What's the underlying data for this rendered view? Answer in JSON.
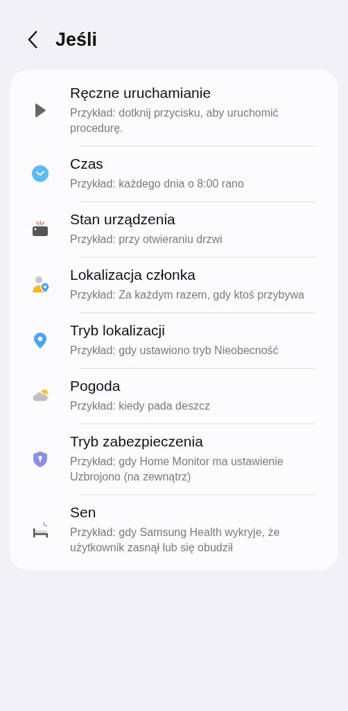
{
  "header": {
    "title": "Jeśli"
  },
  "items": [
    {
      "kind": "manual",
      "title": "Ręczne uruchamianie",
      "subtitle": "Przykład: dotknij przycisku, aby uruchomić procedurę."
    },
    {
      "kind": "time",
      "title": "Czas",
      "subtitle": "Przykład: każdego dnia o 8:00 rano"
    },
    {
      "kind": "device",
      "title": "Stan urządzenia",
      "subtitle": "Przykład: przy otwieraniu drzwi"
    },
    {
      "kind": "member",
      "title": "Lokalizacja członka",
      "subtitle": "Przykład: Za każdym razem, gdy ktoś przybywa"
    },
    {
      "kind": "location",
      "title": "Tryb lokalizacji",
      "subtitle": "Przykład: gdy ustawiono tryb Nieobecność"
    },
    {
      "kind": "weather",
      "title": "Pogoda",
      "subtitle": "Przykład: kiedy pada deszcz"
    },
    {
      "kind": "security",
      "title": "Tryb zabezpieczenia",
      "subtitle": "Przykład: gdy Home Monitor ma ustawienie Uzbrojono (na zewnątrz)"
    },
    {
      "kind": "sleep",
      "title": "Sen",
      "subtitle": "Przykład: gdy Samsung Health wykryje, że użytkownik zasnął lub się obudził"
    }
  ]
}
